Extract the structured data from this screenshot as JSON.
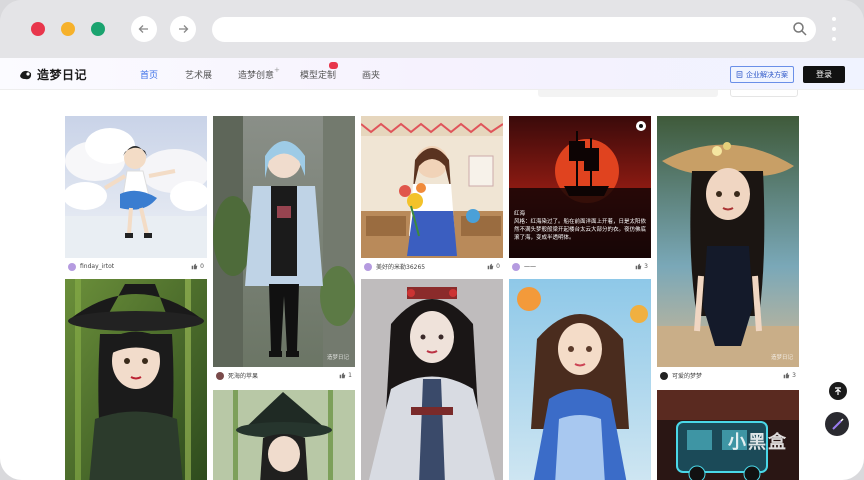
{
  "browser": {
    "nav_back_icon": "arrow-left-icon",
    "nav_forward_icon": "arrow-right-icon",
    "url_search_icon": "search-icon",
    "menu_icon": "kebab-icon"
  },
  "header": {
    "logo_text": "造梦日记",
    "nav": [
      {
        "label": "首页",
        "active": true
      },
      {
        "label": "艺术展",
        "active": false
      },
      {
        "label": "造梦创意",
        "active": false
      },
      {
        "label": "模型定制",
        "active": false
      },
      {
        "label": "画夹",
        "active": false
      }
    ],
    "enterprise_label": "企业解决方案",
    "login_label": "登录"
  },
  "cards": [
    {
      "author": "finday_irtot",
      "likes": "0",
      "caption": "",
      "avatar_color": "#b59be0"
    },
    {
      "author": "死海的苹果",
      "likes": "1",
      "caption": "",
      "avatar_color": "#7a4a4a"
    },
    {
      "author": "美好的米勒36265",
      "likes": "0",
      "caption": "",
      "avatar_color": "#b59be0"
    },
    {
      "author": "一一",
      "likes": "3",
      "caption": "",
      "avatar_color": "#b59be0"
    },
    {
      "author": "可爱的梦梦",
      "likes": "3",
      "caption": "",
      "avatar_color": "#222222"
    }
  ],
  "overlay_text": {
    "card4_title": "红海",
    "card4_body": "风格：红海染过了。船在前面洋面上开着，日是太阳依然不满头梦般般梁开起楼台太云大部分的衣。夜仿佛底滚了海，变成半透明体。"
  },
  "watermarks": {
    "card_wm": "造梦日记",
    "site_wm": "小黑盒"
  },
  "floating": {
    "top_icon": "back-to-top-icon",
    "brush_icon": "brush-icon"
  },
  "colors": {
    "accent": "#3a6ee8",
    "login_bg": "#111111",
    "badge": "#e8364c"
  }
}
